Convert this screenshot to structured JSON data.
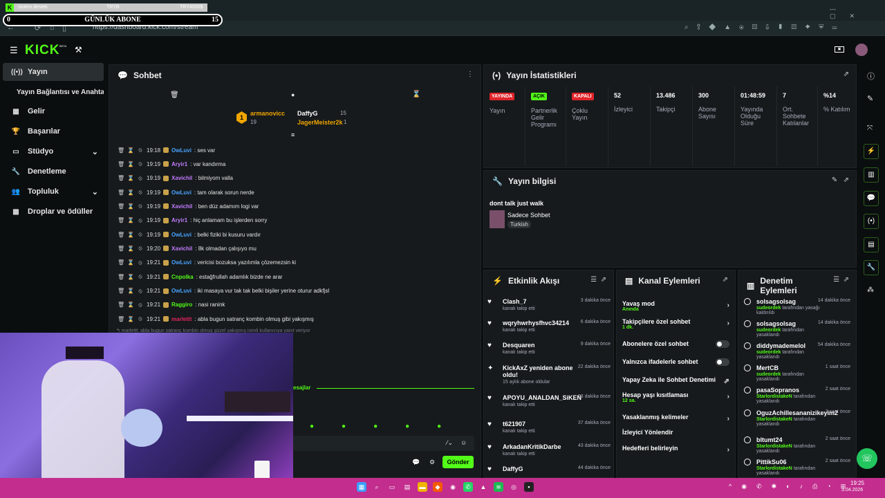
{
  "browser": {
    "tab_title": "sistem destek",
    "overlay_mid": "TRYB",
    "overlay_right": "TRY4500$",
    "url": "https://dashboard.kick.com/stream"
  },
  "goal": {
    "title": "GÜNLÜK ABONE",
    "current": "0",
    "target": "15"
  },
  "kick": {
    "logo": "KICK",
    "beta": "BETA"
  },
  "sidebar": {
    "items": [
      {
        "label": "Yayın",
        "icon": "broadcast-icon"
      },
      {
        "label": "Yayın Bağlantısı ve Anahtarı",
        "icon": ""
      },
      {
        "label": "Gelir",
        "icon": "revenue-icon"
      },
      {
        "label": "Başarılar",
        "icon": "trophy-icon"
      },
      {
        "label": "Stüdyo",
        "icon": "studio-icon"
      },
      {
        "label": "Denetleme",
        "icon": "wrench-icon"
      },
      {
        "label": "Topluluk",
        "icon": "community-icon"
      },
      {
        "label": "Droplar ve ödüller",
        "icon": "drops-icon"
      }
    ]
  },
  "chat": {
    "title": "Sohbet",
    "leaders": {
      "rank": "1",
      "first_name": "armanovicc",
      "first_count": "19",
      "second_name": "DaffyG",
      "second_count": "15",
      "third_name": "JagerMeister2k",
      "third_count": "1"
    },
    "messages": [
      {
        "time": "19:18",
        "user": "OwLuvi",
        "color": "#4aa3ff",
        "text": "ses var"
      },
      {
        "time": "19:19",
        "user": "Aryir1",
        "color": "#c37cff",
        "text": "var kandırma"
      },
      {
        "time": "19:19",
        "user": "Xavichil",
        "color": "#c37cff",
        "text": "bilmiyom valla"
      },
      {
        "time": "19:19",
        "user": "OwLuvi",
        "color": "#4aa3ff",
        "text": "tam olarak sorun nerde"
      },
      {
        "time": "19:19",
        "user": "Xavichil",
        "color": "#c37cff",
        "text": "ben düz adamım logi var"
      },
      {
        "time": "19:19",
        "user": "Aryir1",
        "color": "#c37cff",
        "text": "hiç anlamam bu işlerden sorry"
      },
      {
        "time": "19:19",
        "user": "OwLuvi",
        "color": "#4aa3ff",
        "text": "belki fiziki bi kusuru vardır"
      },
      {
        "time": "19:20",
        "user": "Xavichil",
        "color": "#c37cff",
        "text": "8k olmadan çalışıyo mu"
      },
      {
        "time": "19:21",
        "user": "OwLuvi",
        "color": "#4aa3ff",
        "text": "vericisi bozuksa yazılımla çözemezsin ki"
      },
      {
        "time": "19:21",
        "user": "Cnpolka",
        "color": "#53fc18",
        "text": "estağfrullah adamlık bizde ne arar"
      },
      {
        "time": "19:21",
        "user": "OwLuvi",
        "color": "#4aa3ff",
        "text": "iki masaya vur tak tak belki bişiler yerine oturur adkfjsl"
      },
      {
        "time": "19:21",
        "user": "Raggiro",
        "color": "#53fc18",
        "text": "nasi ranink"
      },
      {
        "time": "19:21",
        "user": "marlettt",
        "color": "#e0245e",
        "text": "abla bugun satranç kombin olmuş gibi yakışmış"
      }
    ],
    "reply_note": "↰ marlettt: abla bugun satranç kombin olmuş güzel yakışmış isimli kullanıcıya yanıt veriyor",
    "messages_divider": "esajlar",
    "send_label": "Gönder"
  },
  "stats": {
    "title": "Yayın İstatistikleri",
    "items": [
      {
        "tag": "YAYINDA",
        "tag_color": "#e0242a",
        "label": "Yayın"
      },
      {
        "tag": "AÇIK",
        "tag_color": "#53fc18",
        "label": "Partnerlik Gelir Programı"
      },
      {
        "tag": "KAPALI",
        "tag_color": "#e0242a",
        "label": "Çoklu Yayın"
      },
      {
        "value": "52",
        "label": "İzleyici"
      },
      {
        "value": "13.486",
        "label": "Takipçi"
      },
      {
        "value": "300",
        "label": "Abone Sayısı"
      },
      {
        "value": "01:48:59",
        "label": "Yayında Olduğu Süre"
      },
      {
        "value": "7",
        "label": "Ort. Sohbete Katılanlar"
      },
      {
        "value": "%14",
        "label": "% Katılım"
      }
    ]
  },
  "info": {
    "title": "Yayın bilgisi",
    "stream_title": "dont talk just walk",
    "category": "Sadece Sohbet",
    "language": "Turkish"
  },
  "activity": {
    "title": "Etkinlik Akışı",
    "items": [
      {
        "name": "Clash_7",
        "sub": "kanalı takip etti",
        "time": "3 dakika önce"
      },
      {
        "name": "wqryhwrhysfhvc34214",
        "sub": "kanalı takip etti",
        "time": "6 dakika önce"
      },
      {
        "name": "Desquaren",
        "sub": "kanalı takip etti",
        "time": "9 dakika önce"
      },
      {
        "name": "KickAxZ yeniden abone oldu!",
        "sub": "15 aylık abone oldular",
        "time": "22 dakika önce"
      },
      {
        "name": "APOYU_ANALDAN_SiKEN",
        "sub": "kanalı takip etti",
        "time": "23 dakika önce"
      },
      {
        "name": "t621907",
        "sub": "kanalı takip etti",
        "time": "37 dakika önce"
      },
      {
        "name": "ArkadanKritikDarbe",
        "sub": "kanalı takip etti",
        "time": "43 dakika önce"
      },
      {
        "name": "DaffyG",
        "sub": "",
        "time": "44 dakika önce"
      }
    ]
  },
  "channel_actions": {
    "title": "Kanal Eylemleri",
    "items": [
      {
        "label": "Yavaş mod",
        "sub": "Anında",
        "control": "arrow"
      },
      {
        "label": "Takipçilere özel sohbet",
        "sub": "1 dk.",
        "control": "arrow"
      },
      {
        "label": "Abonelere özel sohbet",
        "sub": "",
        "control": "toggle"
      },
      {
        "label": "Yalnızca ifadelerle sohbet",
        "sub": "",
        "control": "toggle"
      },
      {
        "label": "Yapay Zeka ile Sohbet Denetimi",
        "sub": "",
        "control": "external"
      },
      {
        "label": "Hesap yaşı kısıtlaması",
        "sub": "12 sa.",
        "control": "arrow"
      },
      {
        "label": "Yasaklanmış kelimeler",
        "sub": "",
        "control": "arrow"
      },
      {
        "label": "İzleyici Yönlendir",
        "sub": "",
        "control": "none"
      },
      {
        "label": "Hedefleri belirleyin",
        "sub": "",
        "control": "arrow"
      }
    ]
  },
  "moderation": {
    "title": "Denetim Eylemleri",
    "items": [
      {
        "name": "solsagsolsag",
        "by": "sudeordek",
        "action": "tarafından yasağı kaldırıldı",
        "time": "14 dakika önce"
      },
      {
        "name": "solsagsolsag",
        "by": "sudeordek",
        "action": "tarafından yasaklandı",
        "time": "14 dakika önce"
      },
      {
        "name": "diddymademelol",
        "by": "sudeordek",
        "action": "tarafından yasaklandı",
        "time": "54 dakika önce"
      },
      {
        "name": "MertCB",
        "by": "sudeordek",
        "action": "tarafından yasaklandı",
        "time": "1 saat önce"
      },
      {
        "name": "pasaSopranos",
        "by": "StarlordistakeN",
        "action": "tarafından yasaklandı",
        "time": "2 saat önce"
      },
      {
        "name": "OguzAchillesananizikeyim2",
        "by": "StarlordistakeN",
        "action": "tarafından yasaklandı",
        "time": "2 saat önce"
      },
      {
        "name": "bltumt24",
        "by": "StarlordistakeN",
        "action": "tarafından yasaklandı",
        "time": "2 saat önce"
      },
      {
        "name": "PittikSu06",
        "by": "StarlordistakeN",
        "action": "tarafından yasaklandı",
        "time": "2 saat önce"
      }
    ]
  },
  "taskbar": {
    "time": "19:25",
    "date": "3.04.2026"
  }
}
